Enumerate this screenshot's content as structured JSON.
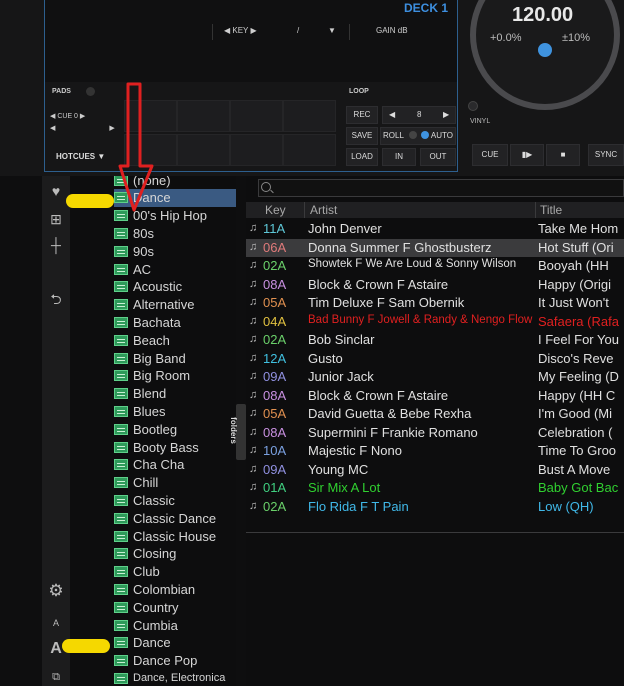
{
  "deck": {
    "title": "DECK 1",
    "bpm": "120.00",
    "pitch_offset": "+0.0%",
    "pitch_range": "±10%",
    "key_label": "◀ KEY ▶",
    "key_slash": "/",
    "key_dropdown": "▼",
    "gain_label": "GAIN dB",
    "pads_label": "PADS",
    "cue_label": "◀ CUE 0 ▶",
    "cue_prev": "◀",
    "cue_next": "▶",
    "hotcues_label": "HOTCUES ▼",
    "loop_label": "LOOP",
    "rec_label": "REC",
    "loop_prev": "◀",
    "loop_size": "8",
    "loop_next": "▶",
    "save_label": "SAVE",
    "roll_label": "ROLL",
    "auto_label": "AUTO",
    "load_label": "LOAD",
    "in_label": "IN",
    "out_label": "OUT",
    "vinyl_label": "VINYL",
    "cue_button": "CUE",
    "play_button": "▮▶",
    "stop_button": "■",
    "sync_button": "SYNC"
  },
  "tree": {
    "selected_index": 1,
    "folders": [
      "(none)",
      "Dance",
      "00's Hip Hop",
      "80s",
      "90s",
      "AC",
      "Acoustic",
      "Alternative",
      "Bachata",
      "Beach",
      "Big Band",
      "Big Room",
      "Blend",
      "Blues",
      "Bootleg",
      "Booty Bass",
      "Cha Cha",
      "Chill",
      "Classic",
      "Classic Dance",
      "Classic House",
      "Closing",
      "Club",
      "Colombian",
      "Country",
      "Cumbia",
      "Dance",
      "Dance Pop",
      "Dance, Electronica"
    ],
    "folders_tab": "folders"
  },
  "browser": {
    "columns": {
      "key": "Key",
      "artist": "Artist",
      "title": "Title"
    },
    "rows": [
      {
        "key": "11A",
        "key_color": "#5ec8d8",
        "artist": "John Denver",
        "title": "Take Me Hom",
        "color": "#e0e0e0"
      },
      {
        "key": "06A",
        "key_color": "#e07a7a",
        "artist": "Donna Summer F Ghostbusterz",
        "title": "Hot Stuff (Ori",
        "color": "#e0e0e0",
        "highlight": true
      },
      {
        "key": "02A",
        "key_color": "#6ad06a",
        "artist": "Showtek F We Are Loud & Sonny Wilson",
        "title": "Booyah (HH",
        "color": "#e0e0e0",
        "small": true
      },
      {
        "key": "08A",
        "key_color": "#c890e0",
        "artist": "Block & Crown F Astaire",
        "title": "Happy (Origi",
        "color": "#e0e0e0"
      },
      {
        "key": "05A",
        "key_color": "#e09050",
        "artist": "Tim Deluxe F Sam Obernik",
        "title": "It Just Won't",
        "color": "#e0e0e0"
      },
      {
        "key": "04A",
        "key_color": "#e0c040",
        "artist": "Bad Bunny F Jowell & Randy & Nengo Flow",
        "title": "Safaera (Rafa",
        "color": "#e02020",
        "small": true
      },
      {
        "key": "02A",
        "key_color": "#6ad06a",
        "artist": "Bob Sinclar",
        "title": "I Feel For You",
        "color": "#e0e0e0"
      },
      {
        "key": "12A",
        "key_color": "#40c0e0",
        "artist": "Gusto",
        "title": "Disco's Reve",
        "color": "#e0e0e0"
      },
      {
        "key": "09A",
        "key_color": "#9090e0",
        "artist": "Junior Jack",
        "title": "My Feeling (D",
        "color": "#e0e0e0"
      },
      {
        "key": "08A",
        "key_color": "#c890e0",
        "artist": "Block & Crown F Astaire",
        "title": "Happy (HH C",
        "color": "#e0e0e0"
      },
      {
        "key": "05A",
        "key_color": "#e09050",
        "artist": "David Guetta & Bebe Rexha",
        "title": "I'm Good (Mi",
        "color": "#e0e0e0"
      },
      {
        "key": "08A",
        "key_color": "#c890e0",
        "artist": "Supermini F Frankie Romano",
        "title": "Celebration (",
        "color": "#e0e0e0"
      },
      {
        "key": "10A",
        "key_color": "#7aa0e0",
        "artist": "Majestic F Nono",
        "title": "Time To Groo",
        "color": "#e0e0e0"
      },
      {
        "key": "09A",
        "key_color": "#9090e0",
        "artist": "Young MC",
        "title": "Bust A Move",
        "color": "#e0e0e0"
      },
      {
        "key": "01A",
        "key_color": "#40d080",
        "artist": "Sir Mix A Lot",
        "title": "Baby Got Bac",
        "color": "#30d030"
      },
      {
        "key": "02A",
        "key_color": "#6ad06a",
        "artist": "Flo Rida F T Pain",
        "title": "Low (QH)",
        "color": "#40b8e8"
      }
    ]
  },
  "colors": {
    "accent": "#3d8fe0",
    "selection": "#3a5a82",
    "annotation_arrow": "#e02020",
    "annotation_marker": "#f5d800"
  }
}
